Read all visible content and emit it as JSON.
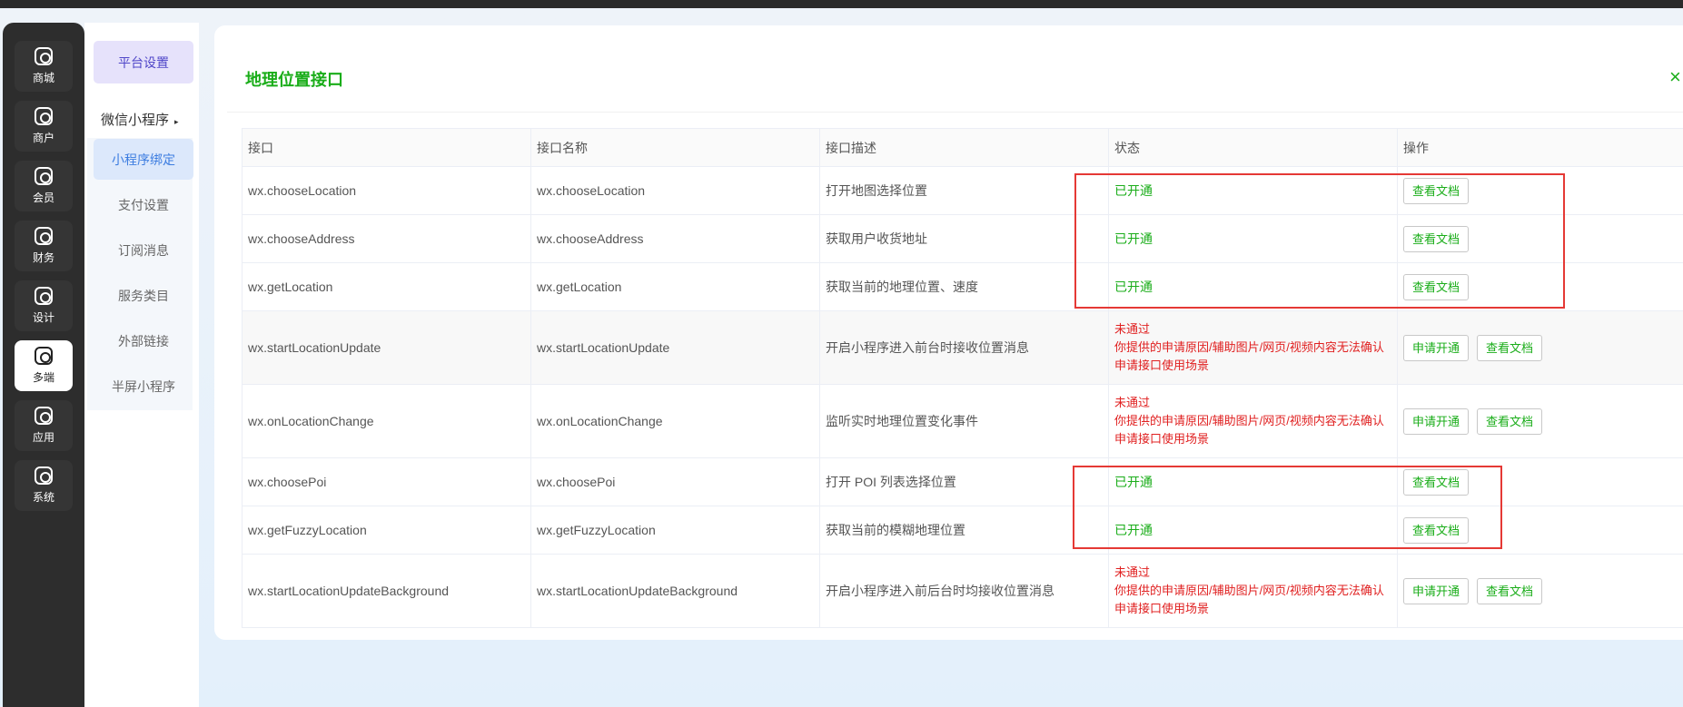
{
  "rail": [
    {
      "label": "商城",
      "icon": "store-icon"
    },
    {
      "label": "商户",
      "icon": "merchant-icon"
    },
    {
      "label": "会员",
      "icon": "member-icon"
    },
    {
      "label": "财务",
      "icon": "finance-icon"
    },
    {
      "label": "设计",
      "icon": "design-icon"
    },
    {
      "label": "多端",
      "icon": "multi-platform-icon",
      "active": true
    },
    {
      "label": "应用",
      "icon": "apps-icon"
    },
    {
      "label": "系统",
      "icon": "system-icon"
    }
  ],
  "submenu": {
    "top": "平台设置",
    "category": "微信小程序",
    "items": [
      "小程序绑定",
      "支付设置",
      "订阅消息",
      "服务类目",
      "外部链接",
      "半屏小程序"
    ],
    "active_index": 0
  },
  "card": {
    "title": "地理位置接口",
    "close": "×"
  },
  "table": {
    "headers": [
      "接口",
      "接口名称",
      "接口描述",
      "状态",
      "操作"
    ],
    "rows": [
      {
        "api": "wx.chooseLocation",
        "name": "wx.chooseLocation",
        "desc": "打开地图选择位置",
        "status": "已开通",
        "reason": "",
        "apply": "",
        "doc": "查看文档"
      },
      {
        "api": "wx.chooseAddress",
        "name": "wx.chooseAddress",
        "desc": "获取用户收货地址",
        "status": "已开通",
        "reason": "",
        "apply": "",
        "doc": "查看文档"
      },
      {
        "api": "wx.getLocation",
        "name": "wx.getLocation",
        "desc": "获取当前的地理位置、速度",
        "status": "已开通",
        "reason": "",
        "apply": "",
        "doc": "查看文档"
      },
      {
        "api": "wx.startLocationUpdate",
        "name": "wx.startLocationUpdate",
        "desc": "开启小程序进入前台时接收位置消息",
        "status": "未通过",
        "reason": "你提供的申请原因/辅助图片/网页/视频内容无法确认申请接口使用场景",
        "apply": "申请开通",
        "doc": "查看文档"
      },
      {
        "api": "wx.onLocationChange",
        "name": "wx.onLocationChange",
        "desc": "监听实时地理位置变化事件",
        "status": "未通过",
        "reason": "你提供的申请原因/辅助图片/网页/视频内容无法确认申请接口使用场景",
        "apply": "申请开通",
        "doc": "查看文档"
      },
      {
        "api": "wx.choosePoi",
        "name": "wx.choosePoi",
        "desc": "打开 POI 列表选择位置",
        "status": "已开通",
        "reason": "",
        "apply": "",
        "doc": "查看文档"
      },
      {
        "api": "wx.getFuzzyLocation",
        "name": "wx.getFuzzyLocation",
        "desc": "获取当前的模糊地理位置",
        "status": "已开通",
        "reason": "",
        "apply": "",
        "doc": "查看文档"
      },
      {
        "api": "wx.startLocationUpdateBackground",
        "name": "wx.startLocationUpdateBackground",
        "desc": "开启小程序进入前后台时均接收位置消息",
        "status": "未通过",
        "reason": "你提供的申请原因/辅助图片/网页/视频内容无法确认申请接口使用场景",
        "apply": "申请开通",
        "doc": "查看文档"
      }
    ]
  },
  "colors": {
    "accent_green": "#1aad19",
    "fail_red": "#e02020",
    "highlight_box": "#e53935",
    "active_sub_blue": "#3d7de0",
    "top_menu_purple": "#4f46c8"
  }
}
